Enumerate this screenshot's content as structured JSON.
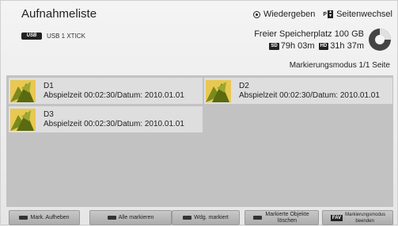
{
  "header": {
    "title": "Aufnahmeliste",
    "device_icon_text": "USB",
    "device_label": "USB 1 XTICK"
  },
  "legend": {
    "play_label": "Wiedergeben",
    "page_icon": "P",
    "page_label": "Seitenwechsel"
  },
  "storage": {
    "free_label": "Freier Speicherplatz 100 GB",
    "sd_badge": "SD",
    "sd_time": "79h 03m",
    "hd_badge": "HD",
    "hd_time": "31h 37m",
    "used_fraction": 0.25
  },
  "mode_label": "Markierungsmodus 1/1 Seite",
  "recordings": [
    {
      "name": "D1",
      "info": "Abspielzeit 00:02:30/Datum: 2010.01.01"
    },
    {
      "name": "D2",
      "info": "Abspielzeit 00:02:30/Datum: 2010.01.01"
    },
    {
      "name": "D3",
      "info": "Abspielzeit 00:02:30/Datum: 2010.01.01"
    }
  ],
  "footer": {
    "unmark": "Mark. Aufheben",
    "mark_all": "Alle markieren",
    "play_marked": "Wdg. markiert",
    "delete_marked": "Markierte Objekte löschen",
    "fav_icon": "FAV",
    "exit_mode": "Markierungsmodus beenden"
  },
  "colors": {
    "list_bg": "#c2c2c2",
    "item_bg": "#dedede",
    "thumb_leaf": "#7a8a1c"
  }
}
